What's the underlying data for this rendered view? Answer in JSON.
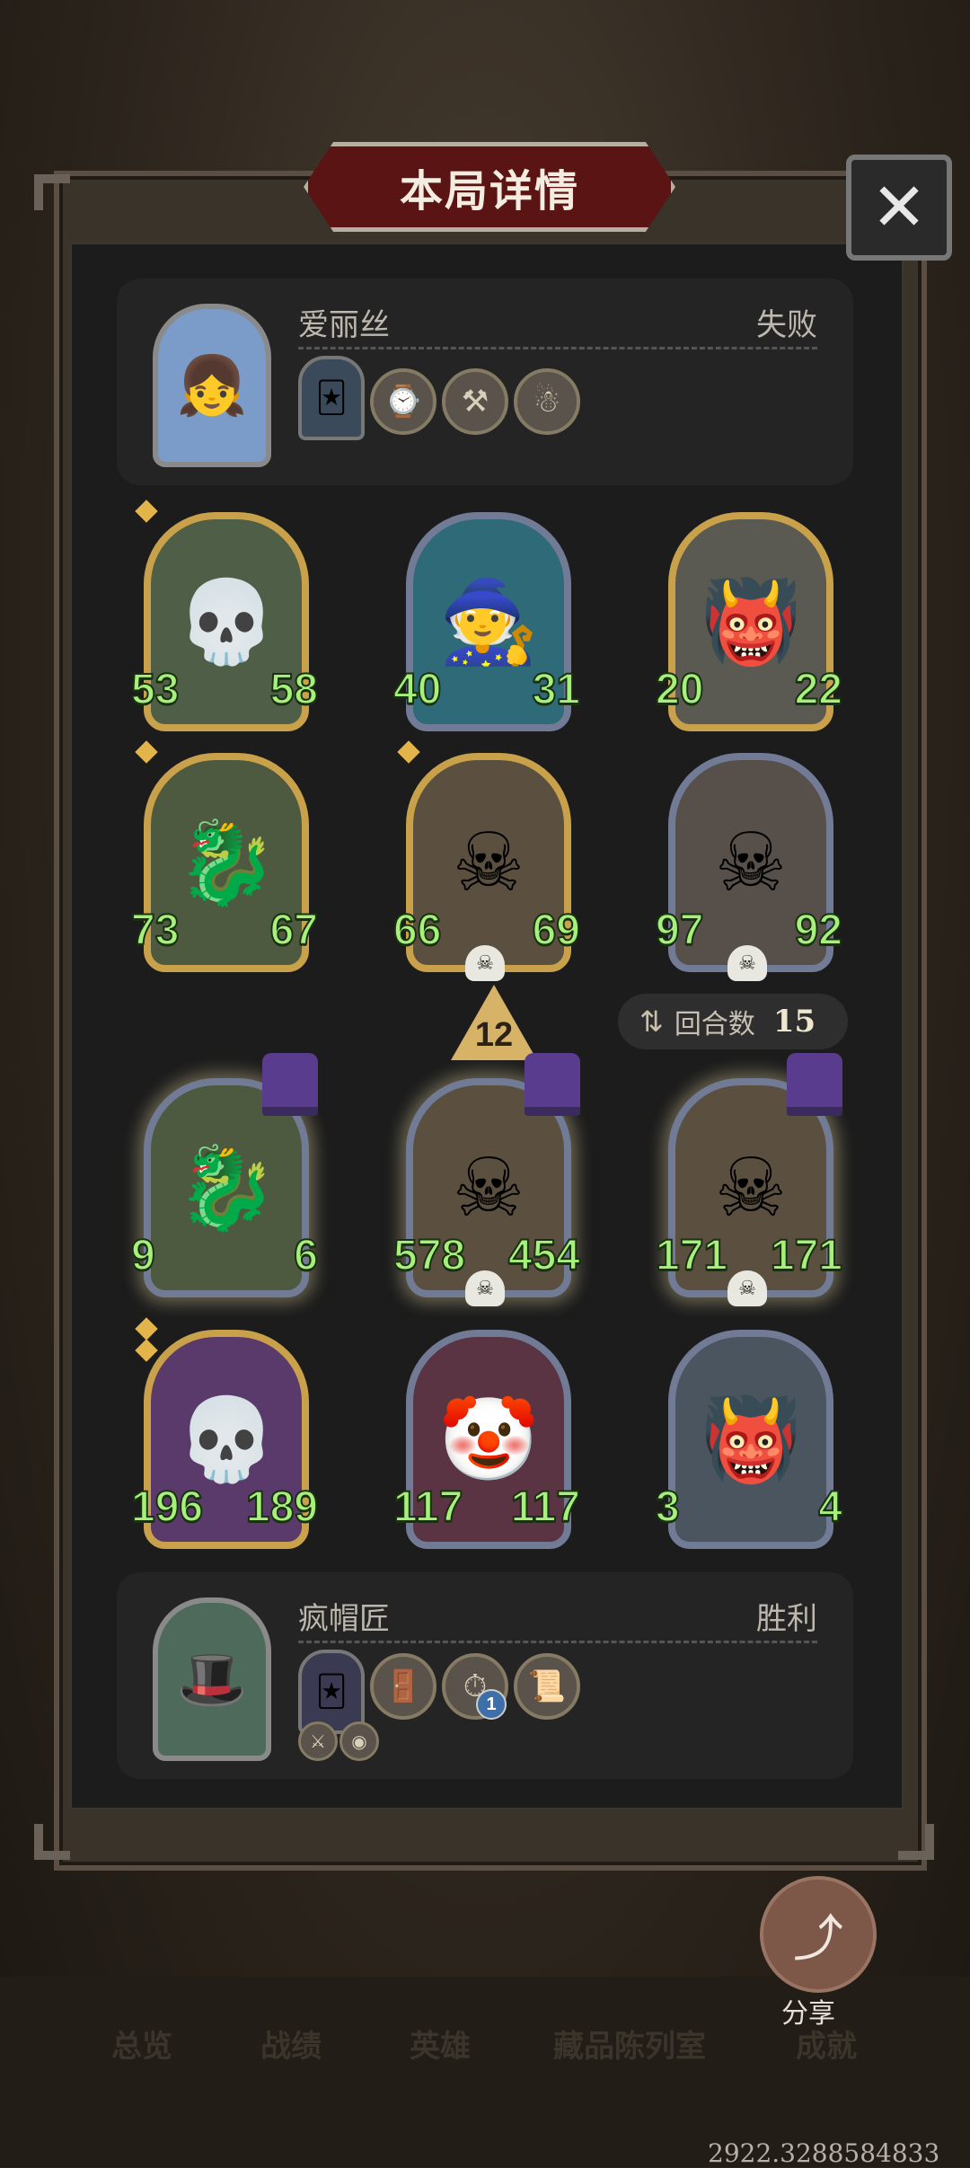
{
  "dialog": {
    "title": "本局详情",
    "close_icon": "close-icon"
  },
  "top_player": {
    "name": "爱丽丝",
    "result": "失败",
    "equipment": [
      "hero-card-icon",
      "pocket-watch-icon",
      "magic-axe-icon",
      "voodoo-doll-icon"
    ]
  },
  "rows_top": [
    [
      {
        "atk": "53",
        "hp": "58",
        "frame": "gold"
      },
      {
        "atk": "40",
        "hp": "31",
        "frame": "silver"
      },
      {
        "atk": "20",
        "hp": "22",
        "frame": "gold"
      }
    ],
    [
      {
        "atk": "73",
        "hp": "67",
        "frame": "gold"
      },
      {
        "atk": "66",
        "hp": "69",
        "frame": "gold"
      },
      {
        "atk": "97",
        "hp": "92",
        "frame": "silver"
      }
    ]
  ],
  "rows_bottom": [
    [
      {
        "atk": "9",
        "hp": "6",
        "frame": "silver"
      },
      {
        "atk": "578",
        "hp": "454",
        "frame": "silver"
      },
      {
        "atk": "171",
        "hp": "171",
        "frame": "silver"
      }
    ],
    [
      {
        "atk": "196",
        "hp": "189",
        "frame": "gold"
      },
      {
        "atk": "117",
        "hp": "117",
        "frame": "silver"
      },
      {
        "atk": "3",
        "hp": "4",
        "frame": "silver"
      }
    ]
  ],
  "level_arrow": {
    "value": "12"
  },
  "round": {
    "label": "回合数",
    "value": "15"
  },
  "bottom_player": {
    "name": "疯帽匠",
    "result": "胜利",
    "equipment_badge": "1"
  },
  "share": {
    "label": "分享"
  },
  "nav": [
    "总览",
    "战绩",
    "英雄",
    "藏品陈列室",
    "成就"
  ],
  "coordinates_text": "2922.3288584833"
}
